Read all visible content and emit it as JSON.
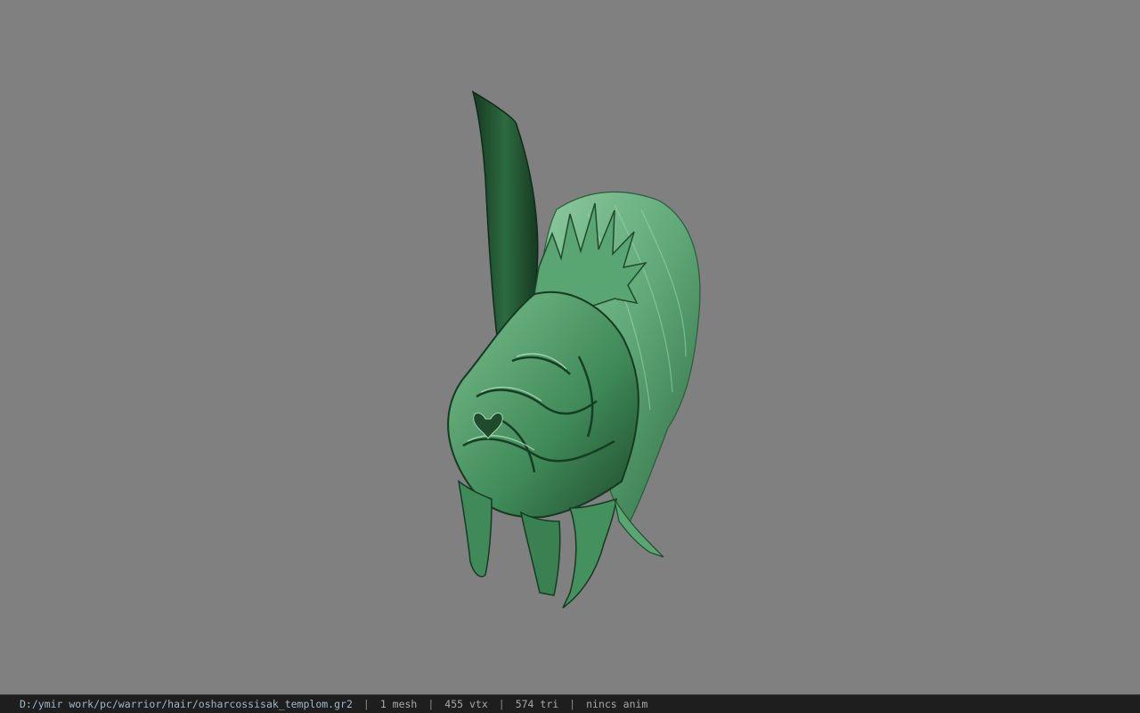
{
  "viewer": {
    "background_color": "#808080",
    "model": {
      "name": "osharcossisak_templom",
      "icon": "green-helmet-model",
      "colors": {
        "dark": "#1f4a2c",
        "mid": "#3f8a58",
        "light": "#7cc08f",
        "highlight": "#b6e0c0"
      }
    }
  },
  "status": {
    "file_path": "D:/ymir work/pc/warrior/hair/osharcossisak_templom.gr2",
    "separator": "|",
    "mesh_count": "1 mesh",
    "vertex_count": "455 vtx",
    "triangle_count": "574 tri",
    "animation": "nincs anim"
  }
}
